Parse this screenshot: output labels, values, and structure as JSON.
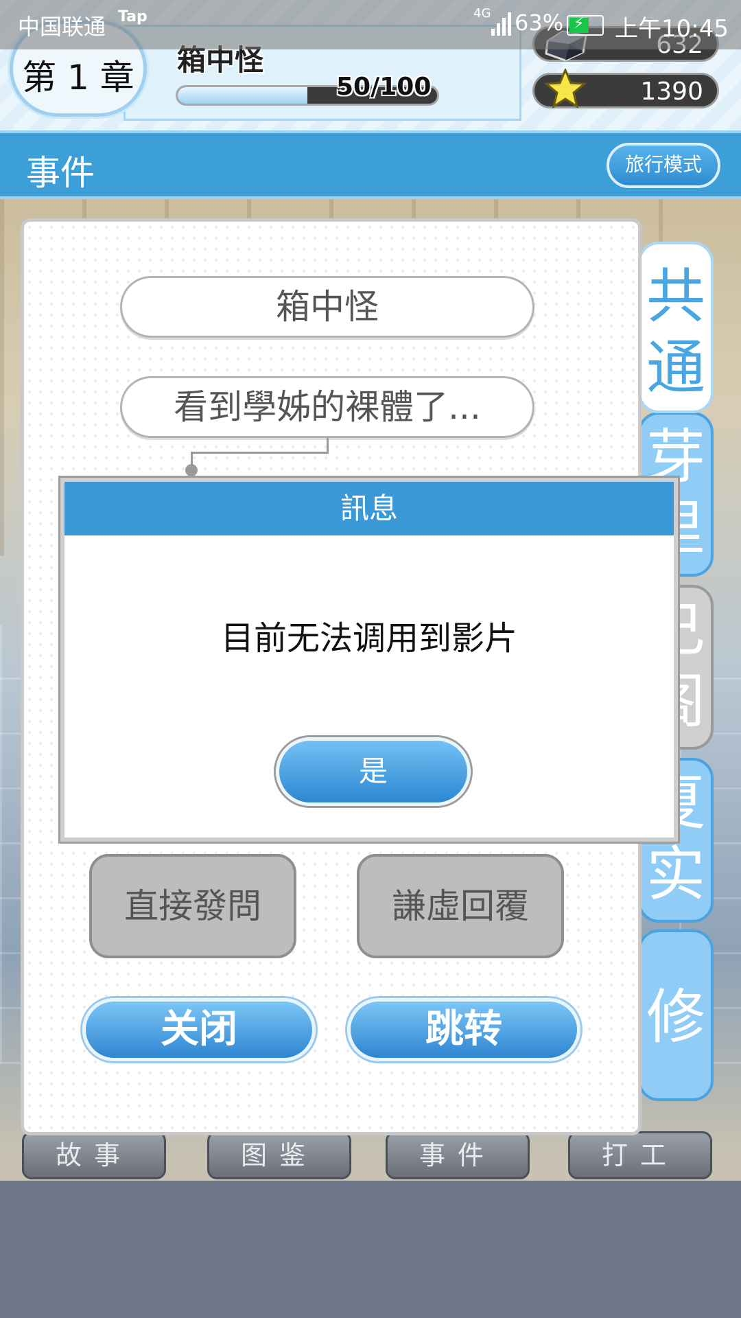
{
  "status_bar": {
    "carrier": "中国联通",
    "app_tag": "Tap",
    "network": "4G",
    "battery": "63%",
    "time": "上午10:45"
  },
  "header": {
    "chapter": "第 1 章",
    "chapter_title": "箱中怪",
    "progress_text": "50/100",
    "progress_value": 0.5,
    "gems": "632",
    "stars": "1390"
  },
  "section": {
    "title": "事件",
    "travel_button": "旅行模式"
  },
  "event_panel": {
    "event_name": "箱中怪",
    "event_step": "看到學姊的裸體了...",
    "choices": [
      "直接發問",
      "謙虛回覆"
    ],
    "close_button": "关闭",
    "jump_button": "跳转"
  },
  "side_tabs": [
    {
      "c1": "共",
      "c2": "通"
    },
    {
      "c1": "芽",
      "c2": "里"
    },
    {
      "c1": "己",
      "c2": "阁"
    },
    {
      "c1": "夏",
      "c2": "实"
    },
    {
      "c1": "修",
      "c2": ""
    }
  ],
  "bottom_nav": [
    "故事",
    "图鉴",
    "事件",
    "打工"
  ],
  "dialog": {
    "title": "訊息",
    "message": "目前无法调用到影片",
    "confirm": "是"
  },
  "colors": {
    "accent_blue": "#3d9fd8",
    "panel_white": "#ffffff",
    "choice_gray": "#bdbdbd"
  }
}
